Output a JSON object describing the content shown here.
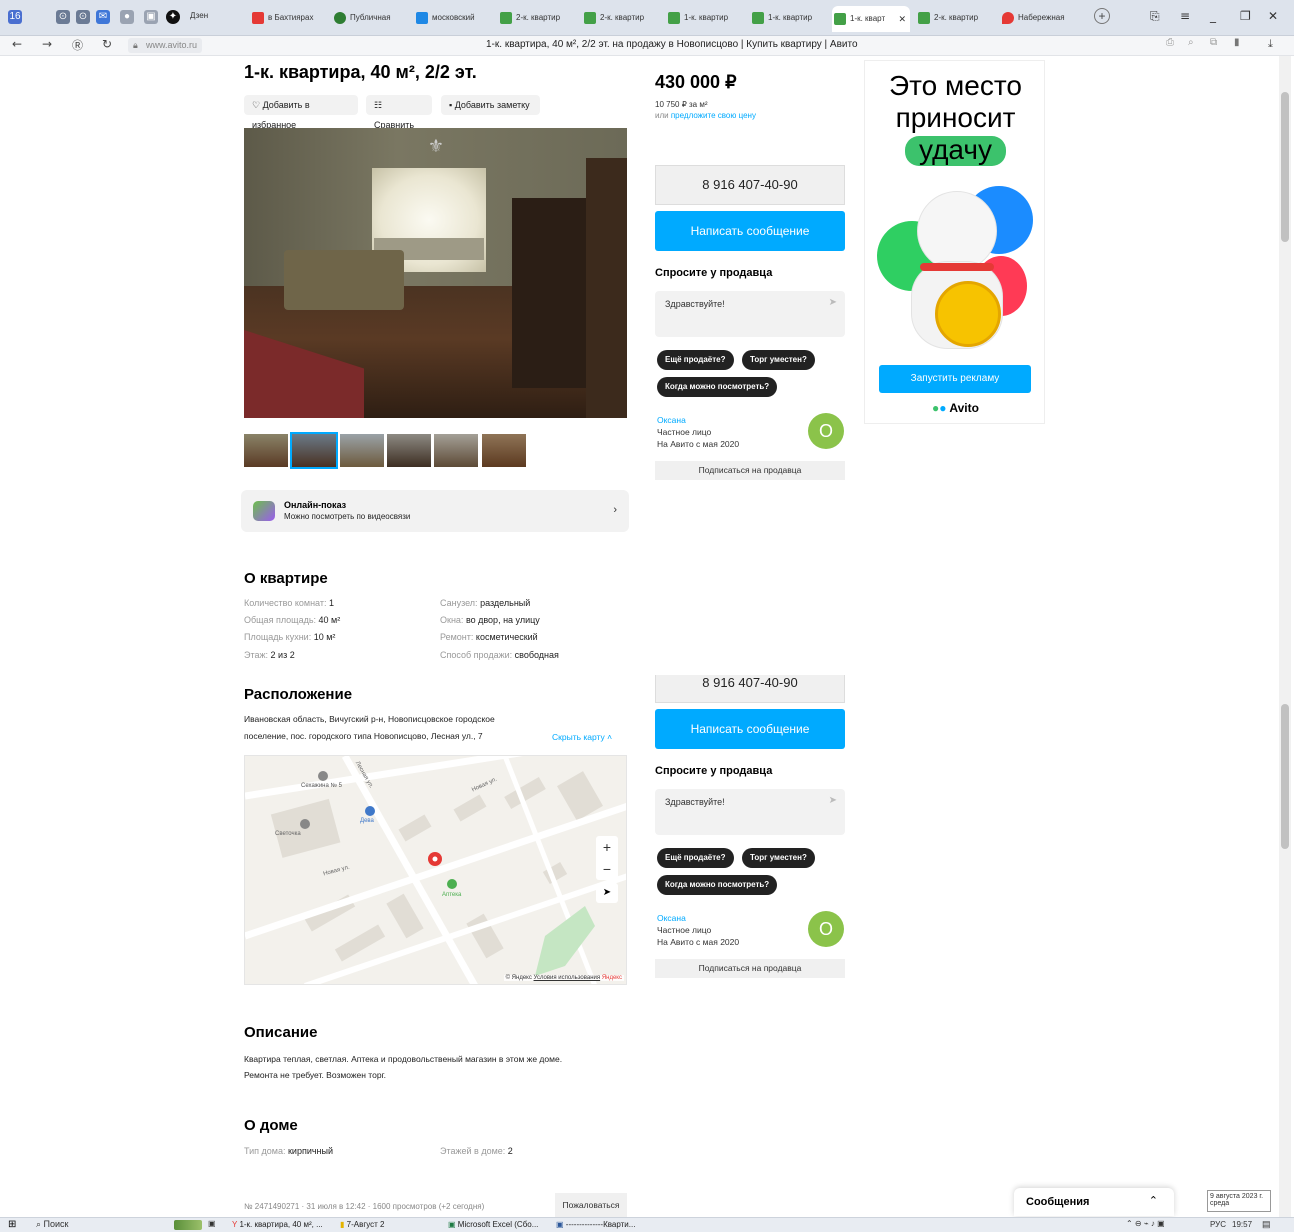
{
  "browser": {
    "tabs": [
      "в Бахтиярах",
      "Публичная",
      "московский",
      "2-к. квартир",
      "2-к. квартир",
      "1-к. квартир",
      "1-к. квартир",
      "1-к. кварт",
      "2-к. квартир",
      "Набережная"
    ],
    "dzen": "Дзен",
    "address": "www.avito.ru",
    "page_title": "1-к. квартира, 40 м², 2/2 эт. на продажу в Новописцово | Купить квартиру | Авито"
  },
  "listing": {
    "title": "1-к. квартира, 40 м², 2/2 эт.",
    "actions": [
      "Добавить в избранное",
      "Сравнить",
      "Добавить заметку"
    ],
    "online_title": "Онлайн-показ",
    "online_sub": "Можно посмотреть по видеосвязи",
    "about_title": "О квартире",
    "about_left": [
      {
        "k": "Количество комнат:",
        "v": "1"
      },
      {
        "k": "Общая площадь:",
        "v": "40 м²"
      },
      {
        "k": "Площадь кухни:",
        "v": "10 м²"
      },
      {
        "k": "Этаж:",
        "v": "2 из 2"
      }
    ],
    "about_right": [
      {
        "k": "Санузел:",
        "v": "раздельный"
      },
      {
        "k": "Окна:",
        "v": "во двор, на улицу"
      },
      {
        "k": "Ремонт:",
        "v": "косметический"
      },
      {
        "k": "Способ продажи:",
        "v": "свободная"
      }
    ],
    "location_title": "Расположение",
    "address_1": "Ивановская область, Вичугский р-н, Новописцовское городское",
    "address_2": "поселение, пос. городского типа Новописцово, Лесная ул., 7",
    "hide_map": "Скрыть карту",
    "map_labels": {
      "store": "Сехажина № 5",
      "pharmacy": "Аптека",
      "street1": "Новая ул.",
      "street2": "Лесная ул.",
      "svetochka": "Светочка",
      "deva": "Дева",
      "copyright": "© Яндекс",
      "terms": "Условия использования",
      "yandex": "Яндекс"
    },
    "desc_title": "Описание",
    "desc_1": "Квартира теплая, светлая. Аптека и продовольственый магазин в этом же доме.",
    "desc_2": "Ремонта не требует. Возможен торг.",
    "house_title": "О доме",
    "house_type_k": "Тип дома:",
    "house_type_v": "кирпичный",
    "floors_k": "Этажей в доме:",
    "floors_v": "2",
    "meta": "№ 2471490271 · 31 июля в 12:42 · 1600 просмотров (+2 сегодня)",
    "complain": "Пожаловаться"
  },
  "price": {
    "value": "430 000 ₽",
    "per_m": "10 750 ₽ за м²",
    "or": "или",
    "offer": "предложите свою цену"
  },
  "contact": {
    "phone": "8 916 407-40-90",
    "write": "Написать сообщение",
    "ask_title": "Спросите у продавца",
    "ask_placeholder": "Здравствуйте!",
    "chips": [
      "Ещё продаёте?",
      "Торг уместен?",
      "Когда можно посмотреть?"
    ],
    "seller_name": "Оксана",
    "seller_type": "Частное лицо",
    "seller_since": "На Авито с мая 2020",
    "avatar_letter": "О",
    "subscribe": "Подписаться на продавца"
  },
  "ad": {
    "line1": "Это место",
    "line2": "приносит",
    "line3": "удачу",
    "button": "Запустить рекламу",
    "brand": "Avito"
  },
  "messages_label": "Сообщения",
  "taskbar": {
    "search": "Поиск",
    "items": [
      "1-к. квартира, 40 м², ...",
      "7-Август 2",
      "Microsoft Excel (Сбо...",
      "--------------Кварти..."
    ],
    "lang": "РУС",
    "time": "19:57",
    "date": "9 августа 2023 г.",
    "weekday": "среда"
  }
}
